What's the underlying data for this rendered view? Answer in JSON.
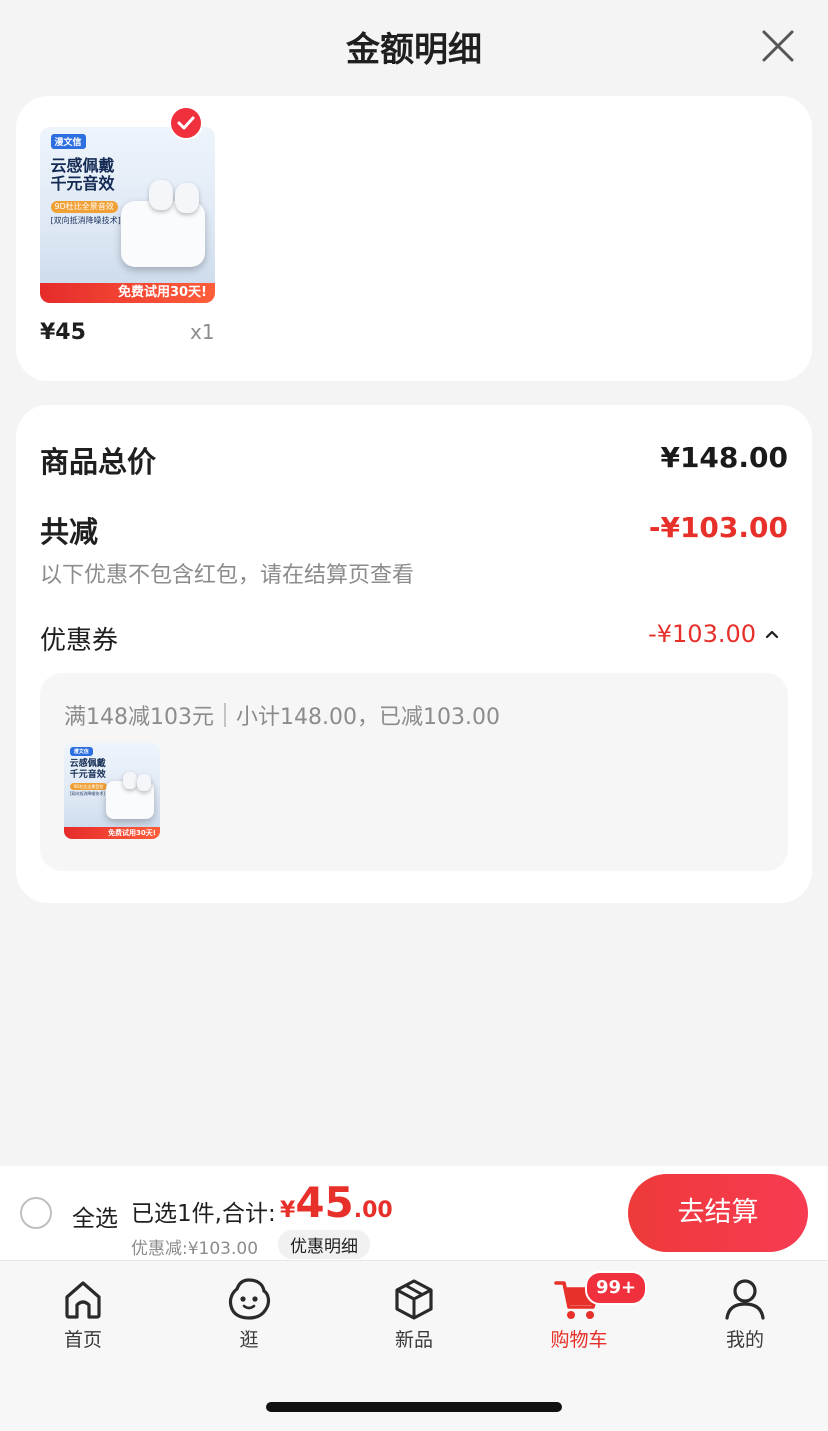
{
  "header": {
    "title": "金额明细"
  },
  "product": {
    "thumb": {
      "brand": "漫文信",
      "headline_line1": "云感佩戴",
      "headline_line2": "千元音效",
      "tag": "9D杜比全景音效",
      "tech": "[双向抵消降噪技术]",
      "promo": "免费试用30天!"
    },
    "price": "¥45",
    "quantity": "x1"
  },
  "summary": {
    "total_label": "商品总价",
    "total_value": "¥148.00",
    "reduce_label": "共减",
    "reduce_value": "-¥103.00",
    "note": "以下优惠不包含红包，请在结算页查看",
    "coupon_label": "优惠券",
    "coupon_value": "-¥103.00"
  },
  "coupon_detail": {
    "rule": "满148减103元",
    "subtotal": "小计148.00，已减103.00"
  },
  "checkout": {
    "select_all": "全选",
    "selected_text": "已选1件,合计:",
    "currency": "¥",
    "total_integer": "45",
    "total_decimal": ".00",
    "discount_text": "优惠减:¥103.00",
    "detail_button": "优惠明细",
    "checkout_button": "去结算"
  },
  "tabs": [
    {
      "label": "首页",
      "icon": "home-icon"
    },
    {
      "label": "逛",
      "icon": "browse-face-icon"
    },
    {
      "label": "新品",
      "icon": "box-icon"
    },
    {
      "label": "购物车",
      "icon": "cart-icon",
      "badge": "99+"
    },
    {
      "label": "我的",
      "icon": "user-icon"
    }
  ],
  "colors": {
    "accent": "#e8302a",
    "background": "#f4f4f4",
    "card": "#ffffff"
  }
}
